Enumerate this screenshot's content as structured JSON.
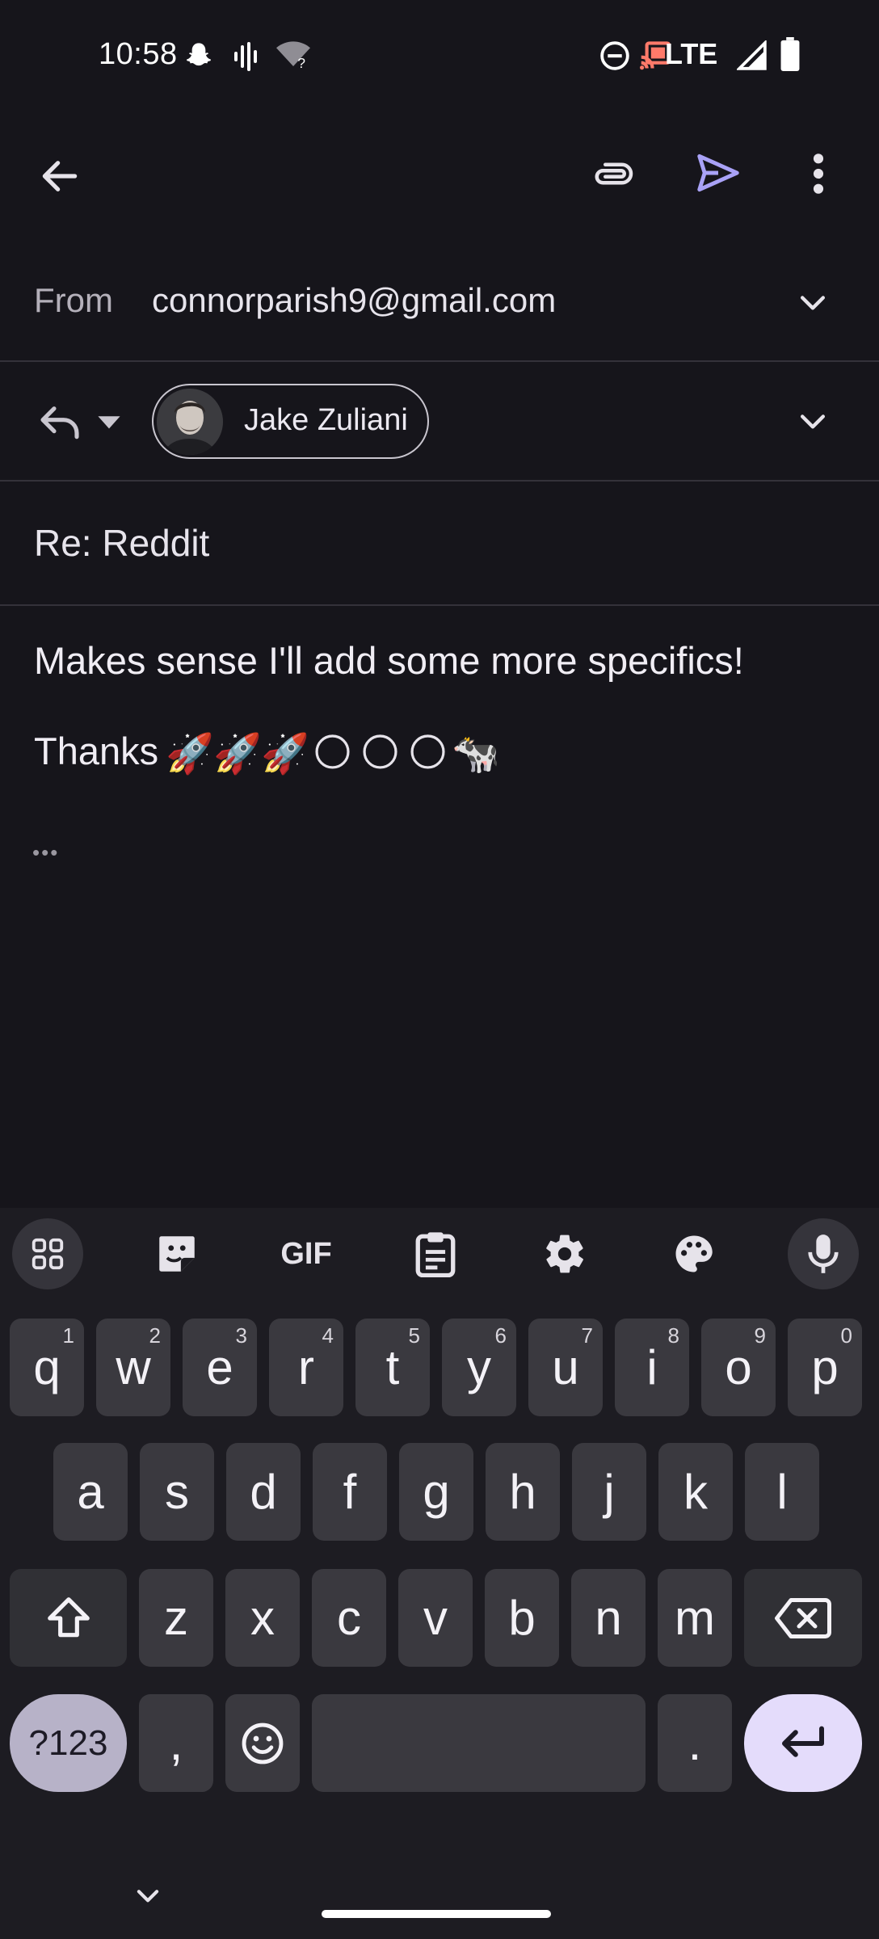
{
  "status_bar": {
    "time": "10:58",
    "network": "LTE",
    "icons": [
      "snapchat-icon",
      "voice-wave-icon",
      "wifi-unknown-icon",
      "dnd-icon",
      "cast-icon",
      "signal-icon",
      "battery-icon"
    ]
  },
  "toolbar": {
    "icons": [
      "back-arrow-icon",
      "paperclip-icon",
      "send-icon",
      "more-vert-icon"
    ],
    "send_color": "#a9a2f7"
  },
  "compose": {
    "from_label": "From",
    "from_value": "connorparish9@gmail.com",
    "recipient_name": "Jake Zuliani",
    "subject": "Re: Reddit",
    "body_line1": "Makes sense I'll add some more specifics!",
    "body_line2": "Thanks",
    "body_emojis": [
      "🚀",
      "🚀",
      "🚀",
      "🌕",
      "🌕",
      "🌕",
      "🐄"
    ],
    "quoted_indicator": "•••"
  },
  "keyboard": {
    "toolbar_icons": [
      "apps-grid-icon",
      "sticker-icon",
      "gif-icon",
      "clipboard-icon",
      "settings-icon",
      "palette-icon",
      "microphone-icon"
    ],
    "gif_label": "GIF",
    "row1": [
      {
        "k": "q",
        "h": "1"
      },
      {
        "k": "w",
        "h": "2"
      },
      {
        "k": "e",
        "h": "3"
      },
      {
        "k": "r",
        "h": "4"
      },
      {
        "k": "t",
        "h": "5"
      },
      {
        "k": "y",
        "h": "6"
      },
      {
        "k": "u",
        "h": "7"
      },
      {
        "k": "i",
        "h": "8"
      },
      {
        "k": "o",
        "h": "9"
      },
      {
        "k": "p",
        "h": "0"
      }
    ],
    "row2": [
      "a",
      "s",
      "d",
      "f",
      "g",
      "h",
      "j",
      "k",
      "l"
    ],
    "row3": [
      "z",
      "x",
      "c",
      "v",
      "b",
      "n",
      "m"
    ],
    "symbols_label": "?123",
    "comma": ",",
    "period": ".",
    "accent": "#e4dcfb"
  }
}
